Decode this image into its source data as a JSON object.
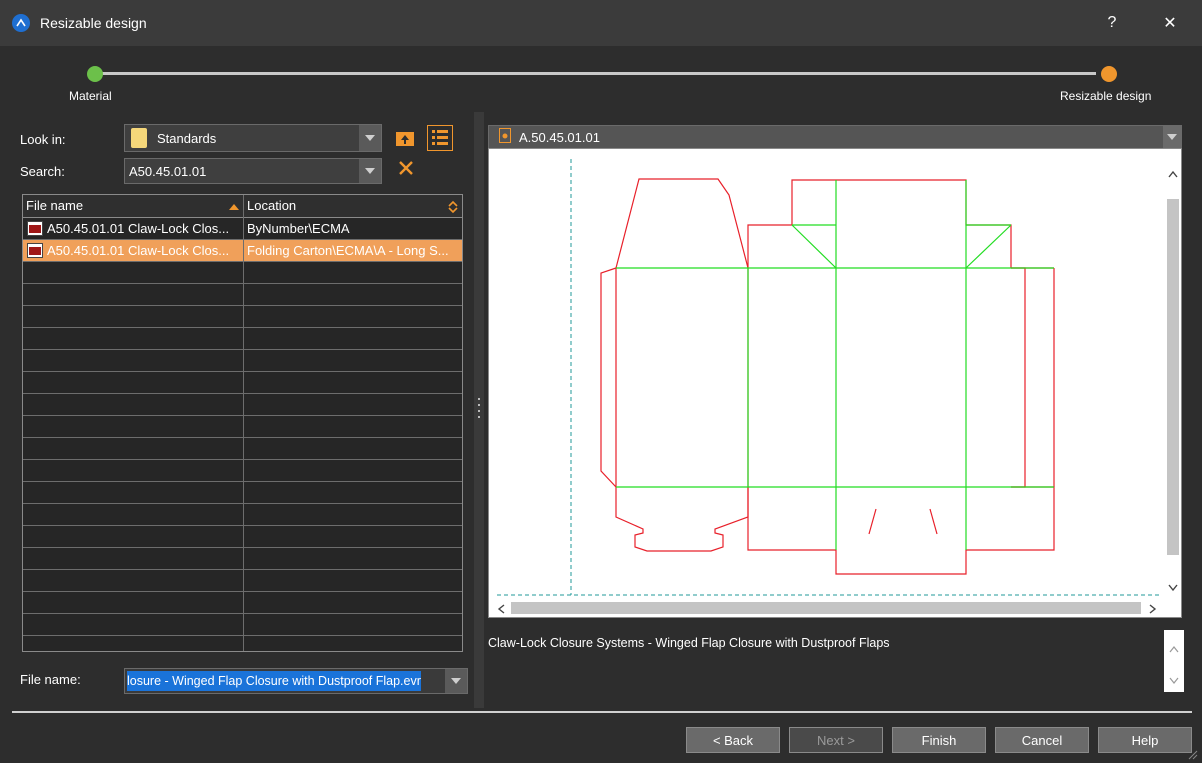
{
  "window": {
    "title": "Resizable design",
    "help_label": "?",
    "close_label": "✕"
  },
  "steps": [
    {
      "label": "Material",
      "color": "#6cc04a"
    },
    {
      "label": "Resizable design",
      "color": "#f0962d"
    }
  ],
  "look_in": {
    "label": "Look in:",
    "value": "Standards"
  },
  "search": {
    "label": "Search:",
    "value": "A50.45.01.01"
  },
  "table": {
    "columns": [
      "File name",
      "Location"
    ],
    "rows": [
      {
        "name": "A50.45.01.01 Claw-Lock Clos...",
        "location": "ByNumber\\ECMA",
        "selected": false
      },
      {
        "name": "A50.45.01.01 Claw-Lock Clos...",
        "location": "Folding Carton\\ECMA\\A - Long S...",
        "selected": true
      }
    ]
  },
  "file_name": {
    "label": "File name:",
    "value": "losure - Winged Flap Closure with Dustproof Flap.evr"
  },
  "preview": {
    "title": "A.50.45.01.01",
    "description": "Claw-Lock Closure Systems - Winged Flap Closure with Dustproof Flaps"
  },
  "buttons": {
    "back": "< Back",
    "next": "Next >",
    "finish": "Finish",
    "cancel": "Cancel",
    "help": "Help"
  },
  "colors": {
    "accent": "#f0962d",
    "cut_line": "#e8202a",
    "crease_line": "#22dd22",
    "selection": "#f0a05a"
  },
  "icons": [
    "app-logo-icon",
    "folder-icon",
    "folder-up-icon",
    "list-view-icon",
    "clear-search-icon",
    "sort-asc-icon",
    "sort-toggle-icon",
    "document-icon",
    "file-icon"
  ]
}
